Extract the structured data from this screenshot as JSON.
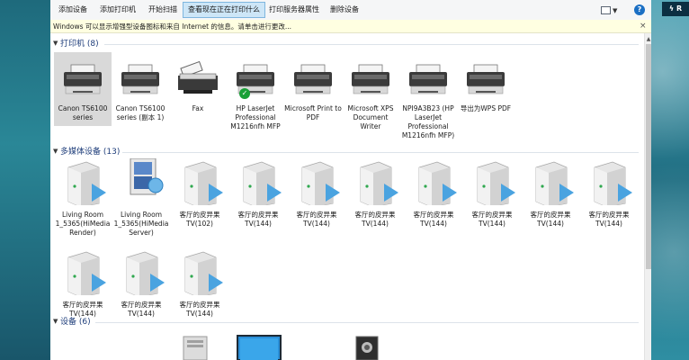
{
  "toolbar": {
    "buttons": [
      {
        "label": "添加设备"
      },
      {
        "label": "添加打印机"
      },
      {
        "label": "开始扫描"
      },
      {
        "label": "查看现在正在打印什么"
      },
      {
        "label": "打印服务器属性"
      },
      {
        "label": "删除设备"
      }
    ],
    "help_icon": "?"
  },
  "infobar": {
    "text": "Windows 可以显示增强型设备图标和来自 Internet 的信息。请单击进行更改...",
    "close": "×"
  },
  "sections": {
    "printers": {
      "title": "打印机 (8)"
    },
    "media": {
      "title": "多媒体设备 (13)"
    },
    "devices": {
      "title": "设备 (6)"
    }
  },
  "printers": [
    {
      "name": "Canon TS6100 series",
      "icon": "printer-icon",
      "selected": true
    },
    {
      "name": "Canon TS6100 series (副本 1)",
      "icon": "printer-icon"
    },
    {
      "name": "Fax",
      "icon": "fax-icon"
    },
    {
      "name": "HP LaserJet Professional M1216nfh MFP",
      "icon": "printer-icon",
      "default": true
    },
    {
      "name": "Microsoft Print to PDF",
      "icon": "printer-icon"
    },
    {
      "name": "Microsoft XPS Document Writer",
      "icon": "printer-icon"
    },
    {
      "name": "NPI9A3B23 (HP LaserJet Professional M1216nfh MFP)",
      "icon": "printer-icon"
    },
    {
      "name": "导出为WPS PDF",
      "icon": "printer-icon"
    }
  ],
  "media": [
    {
      "name": "Living Room 1_5365(HiMediaRender)",
      "icon": "media-server-icon"
    },
    {
      "name": "Living Room 1_5365(HiMediaServer)",
      "icon": "media-library-icon"
    },
    {
      "name": "客厅的皮异果 TV(102)",
      "icon": "media-server-icon"
    },
    {
      "name": "客厅的皮异果 TV(144)",
      "icon": "media-server-icon"
    },
    {
      "name": "客厅的皮异果 TV(144)",
      "icon": "media-server-icon"
    },
    {
      "name": "客厅的皮异果 TV(144)",
      "icon": "media-server-icon"
    },
    {
      "name": "客厅的皮异果 TV(144)",
      "icon": "media-server-icon"
    },
    {
      "name": "客厅的皮异果 TV(144)",
      "icon": "media-server-icon"
    },
    {
      "name": "客厅的皮异果 TV(144)",
      "icon": "media-server-icon"
    },
    {
      "name": "客厅的皮异果 TV(144)",
      "icon": "media-server-icon"
    },
    {
      "name": "客厅的皮异果 TV(144)",
      "icon": "media-server-icon"
    },
    {
      "name": "客厅的皮异果 TV(144)",
      "icon": "media-server-icon"
    },
    {
      "name": "客厅的皮异果 TV(144)",
      "icon": "media-server-icon"
    }
  ],
  "devices_visible_icons": [
    "computer-tower-icon",
    "monitor-icon",
    "speaker-icon"
  ],
  "colors": {
    "section_title": "#1e3d7a",
    "selected_bg": "#d9d9d9",
    "default_check": "#1aa037",
    "media_arrow": "#4aa3e0"
  }
}
